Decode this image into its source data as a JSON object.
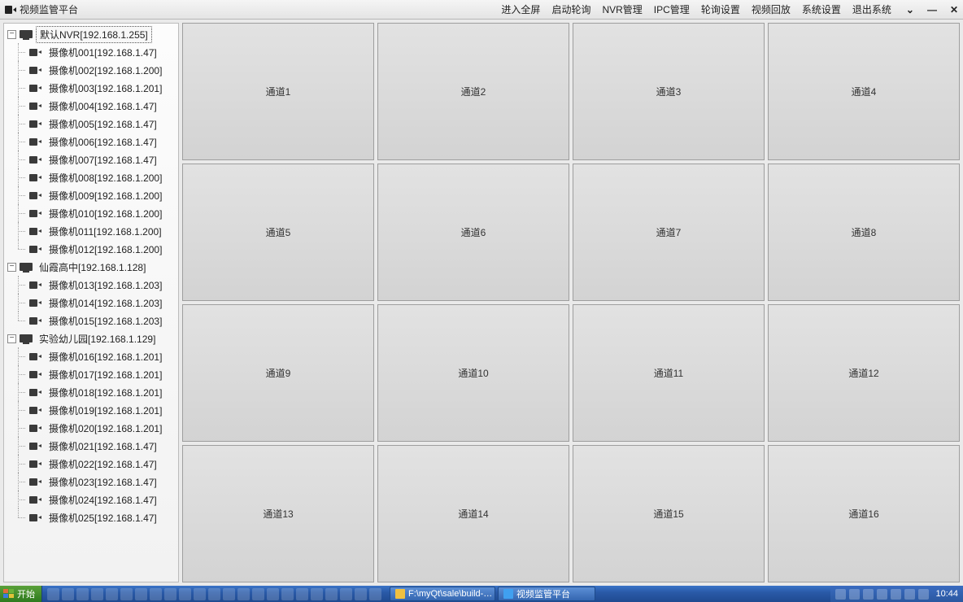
{
  "app": {
    "title": "视频监管平台"
  },
  "menu": {
    "fullscreen": "进入全屏",
    "start_poll": "启动轮询",
    "nvr_mgmt": "NVR管理",
    "ipc_mgmt": "IPC管理",
    "poll_settings": "轮询设置",
    "playback": "视频回放",
    "sys_settings": "系统设置",
    "exit_sys": "退出系统"
  },
  "window_buttons": {
    "dropdown": "⌄",
    "minimize": "—",
    "close": "✕"
  },
  "tree": {
    "nvrs": [
      {
        "label": "默认NVR[192.168.1.255]",
        "selected": true,
        "cameras": [
          "摄像机001[192.168.1.47]",
          "摄像机002[192.168.1.200]",
          "摄像机003[192.168.1.201]",
          "摄像机004[192.168.1.47]",
          "摄像机005[192.168.1.47]",
          "摄像机006[192.168.1.47]",
          "摄像机007[192.168.1.47]",
          "摄像机008[192.168.1.200]",
          "摄像机009[192.168.1.200]",
          "摄像机010[192.168.1.200]",
          "摄像机011[192.168.1.200]",
          "摄像机012[192.168.1.200]"
        ]
      },
      {
        "label": "仙霞高中[192.168.1.128]",
        "selected": false,
        "cameras": [
          "摄像机013[192.168.1.203]",
          "摄像机014[192.168.1.203]",
          "摄像机015[192.168.1.203]"
        ]
      },
      {
        "label": "实验幼儿园[192.168.1.129]",
        "selected": false,
        "cameras": [
          "摄像机016[192.168.1.201]",
          "摄像机017[192.168.1.201]",
          "摄像机018[192.168.1.201]",
          "摄像机019[192.168.1.201]",
          "摄像机020[192.168.1.201]",
          "摄像机021[192.168.1.47]",
          "摄像机022[192.168.1.47]",
          "摄像机023[192.168.1.47]",
          "摄像机024[192.168.1.47]",
          "摄像机025[192.168.1.47]"
        ]
      }
    ]
  },
  "channels": [
    "通道1",
    "通道2",
    "通道3",
    "通道4",
    "通道5",
    "通道6",
    "通道7",
    "通道8",
    "通道9",
    "通道10",
    "通道11",
    "通道12",
    "通道13",
    "通道14",
    "通道15",
    "通道16"
  ],
  "taskbar": {
    "start": "开始",
    "items": [
      {
        "label": "F:\\myQt\\sale\\build-…",
        "kind": "folder"
      },
      {
        "label": "视频监管平台",
        "kind": "app"
      }
    ],
    "clock": "10:44"
  }
}
